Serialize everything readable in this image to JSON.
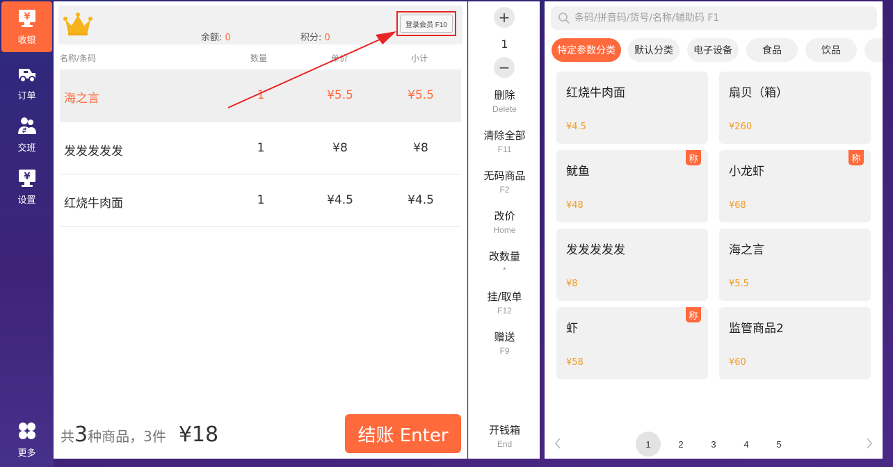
{
  "sidebar": {
    "items": [
      {
        "label": "收银",
        "icon": "cashier-icon",
        "active": true
      },
      {
        "label": "订单",
        "icon": "order-icon"
      },
      {
        "label": "交班",
        "icon": "shift-icon"
      },
      {
        "label": "设置",
        "icon": "settings-icon"
      },
      {
        "label": "更多",
        "icon": "more-icon"
      }
    ]
  },
  "member": {
    "balance_label": "余额:",
    "balance_value": "0",
    "points_label": "积分:",
    "points_value": "0",
    "login_label": "登录会员 F10"
  },
  "table": {
    "headers": [
      "名称/条码",
      "数量",
      "单价",
      "小计"
    ],
    "rows": [
      {
        "name": "海之言",
        "qty": "1",
        "price": "¥5.5",
        "subtotal": "¥5.5",
        "selected": true
      },
      {
        "name": "发发发发发",
        "qty": "1",
        "price": "¥8",
        "subtotal": "¥8"
      },
      {
        "name": "红烧牛肉面",
        "qty": "1",
        "price": "¥4.5",
        "subtotal": "¥4.5"
      }
    ]
  },
  "summary": {
    "prefix": "共",
    "kinds": "3",
    "middle": "种商品，3件",
    "total": "¥18",
    "checkout_label": "结账 Enter"
  },
  "actions": {
    "plus": "+",
    "minus": "−",
    "quantity": "1",
    "items": [
      {
        "label": "删除",
        "key": "Delete"
      },
      {
        "label": "清除全部",
        "key": "F11"
      },
      {
        "label": "无码商品",
        "key": "F2"
      },
      {
        "label": "改价",
        "key": "Home"
      },
      {
        "label": "改数量",
        "key": "*"
      },
      {
        "label": "挂/取单",
        "key": "F12"
      },
      {
        "label": "赠送",
        "key": "F9"
      }
    ],
    "cash_drawer": {
      "label": "开钱箱",
      "key": "End"
    }
  },
  "search": {
    "placeholder": "条码/拼音码/货号/名称/辅助码 F1"
  },
  "categories": [
    {
      "label": "特定参数分类",
      "active": true
    },
    {
      "label": "默认分类"
    },
    {
      "label": "电子设备"
    },
    {
      "label": "食品"
    },
    {
      "label": "饮品"
    }
  ],
  "products": [
    {
      "name": "红烧牛肉面",
      "price": "¥4.5"
    },
    {
      "name": "扇贝（箱）",
      "price": "¥260"
    },
    {
      "name": "鱿鱼",
      "price": "¥48",
      "tag": "称"
    },
    {
      "name": "小龙虾",
      "price": "¥68",
      "tag": "称"
    },
    {
      "name": "发发发发发",
      "price": "¥8"
    },
    {
      "name": "海之言",
      "price": "¥5.5"
    },
    {
      "name": "虾",
      "price": "¥58",
      "tag": "称"
    },
    {
      "name": "监管商品2",
      "price": "¥60"
    }
  ],
  "pagination": {
    "pages": [
      "1",
      "2",
      "3",
      "4",
      "5"
    ],
    "current": "1"
  },
  "colors": {
    "accent": "#ff6a3d",
    "price": "#f39a1e",
    "highlight_box": "#e82424"
  }
}
